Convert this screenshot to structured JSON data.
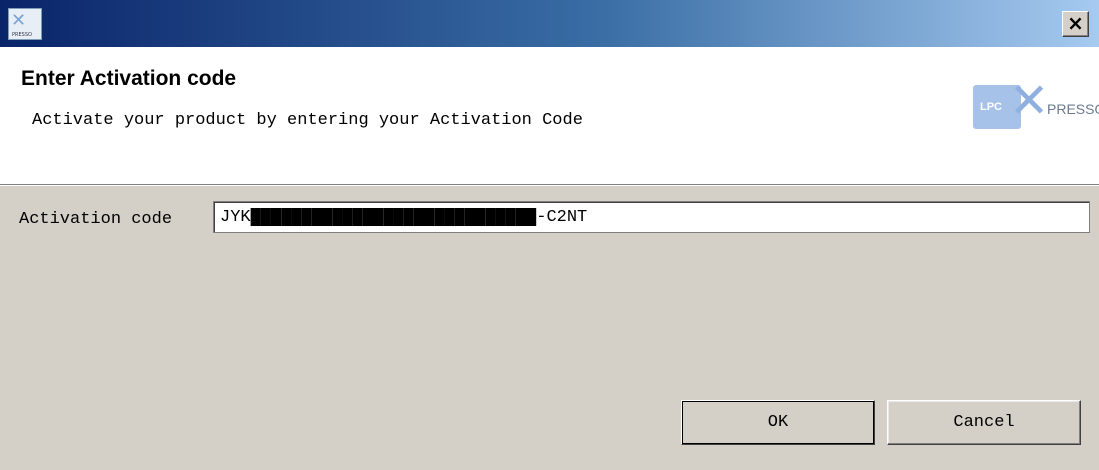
{
  "window": {
    "app_icon": "lpcxpresso-icon",
    "app_icon_text": "PRESSO",
    "close_label": "×"
  },
  "header": {
    "title": "Enter Activation code",
    "description": "Activate your product by entering your Activation Code",
    "logo": {
      "part1": "LPC",
      "part2": "PRESSO"
    }
  },
  "form": {
    "activation_label": "Activation code",
    "activation_value": "JYK████████████████████████████-C2NT"
  },
  "buttons": {
    "ok": "OK",
    "cancel": "Cancel"
  }
}
